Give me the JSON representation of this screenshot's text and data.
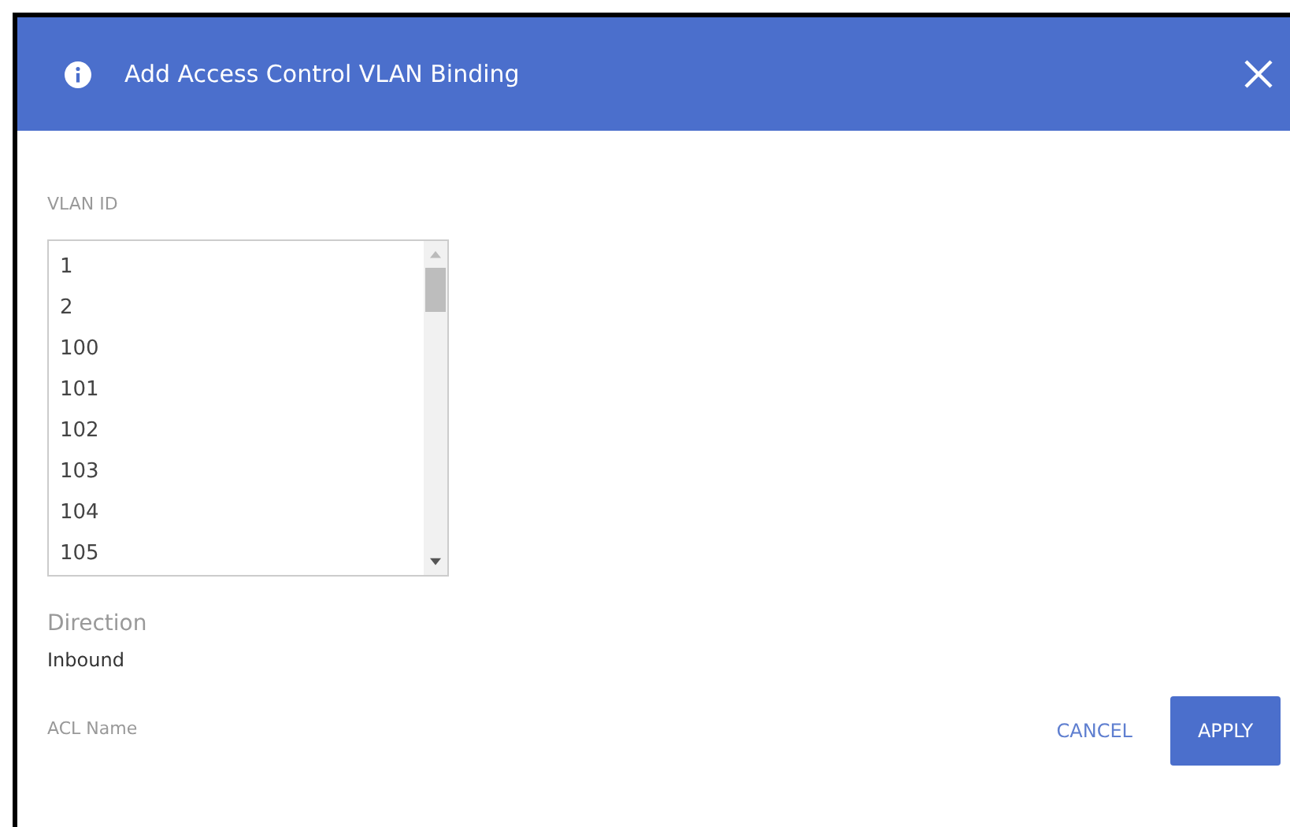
{
  "dialog": {
    "title": "Add Access Control VLAN Binding"
  },
  "vlan_id": {
    "label": "VLAN ID",
    "options": [
      "1",
      "2",
      "100",
      "101",
      "102",
      "103",
      "104",
      "105"
    ]
  },
  "direction": {
    "label": "Direction",
    "value": "Inbound"
  },
  "acl_name": {
    "label": "ACL Name"
  },
  "buttons": [
    {
      "label": "CANCEL",
      "kind": "text"
    },
    {
      "label": "APPLY",
      "kind": "primary"
    }
  ]
}
